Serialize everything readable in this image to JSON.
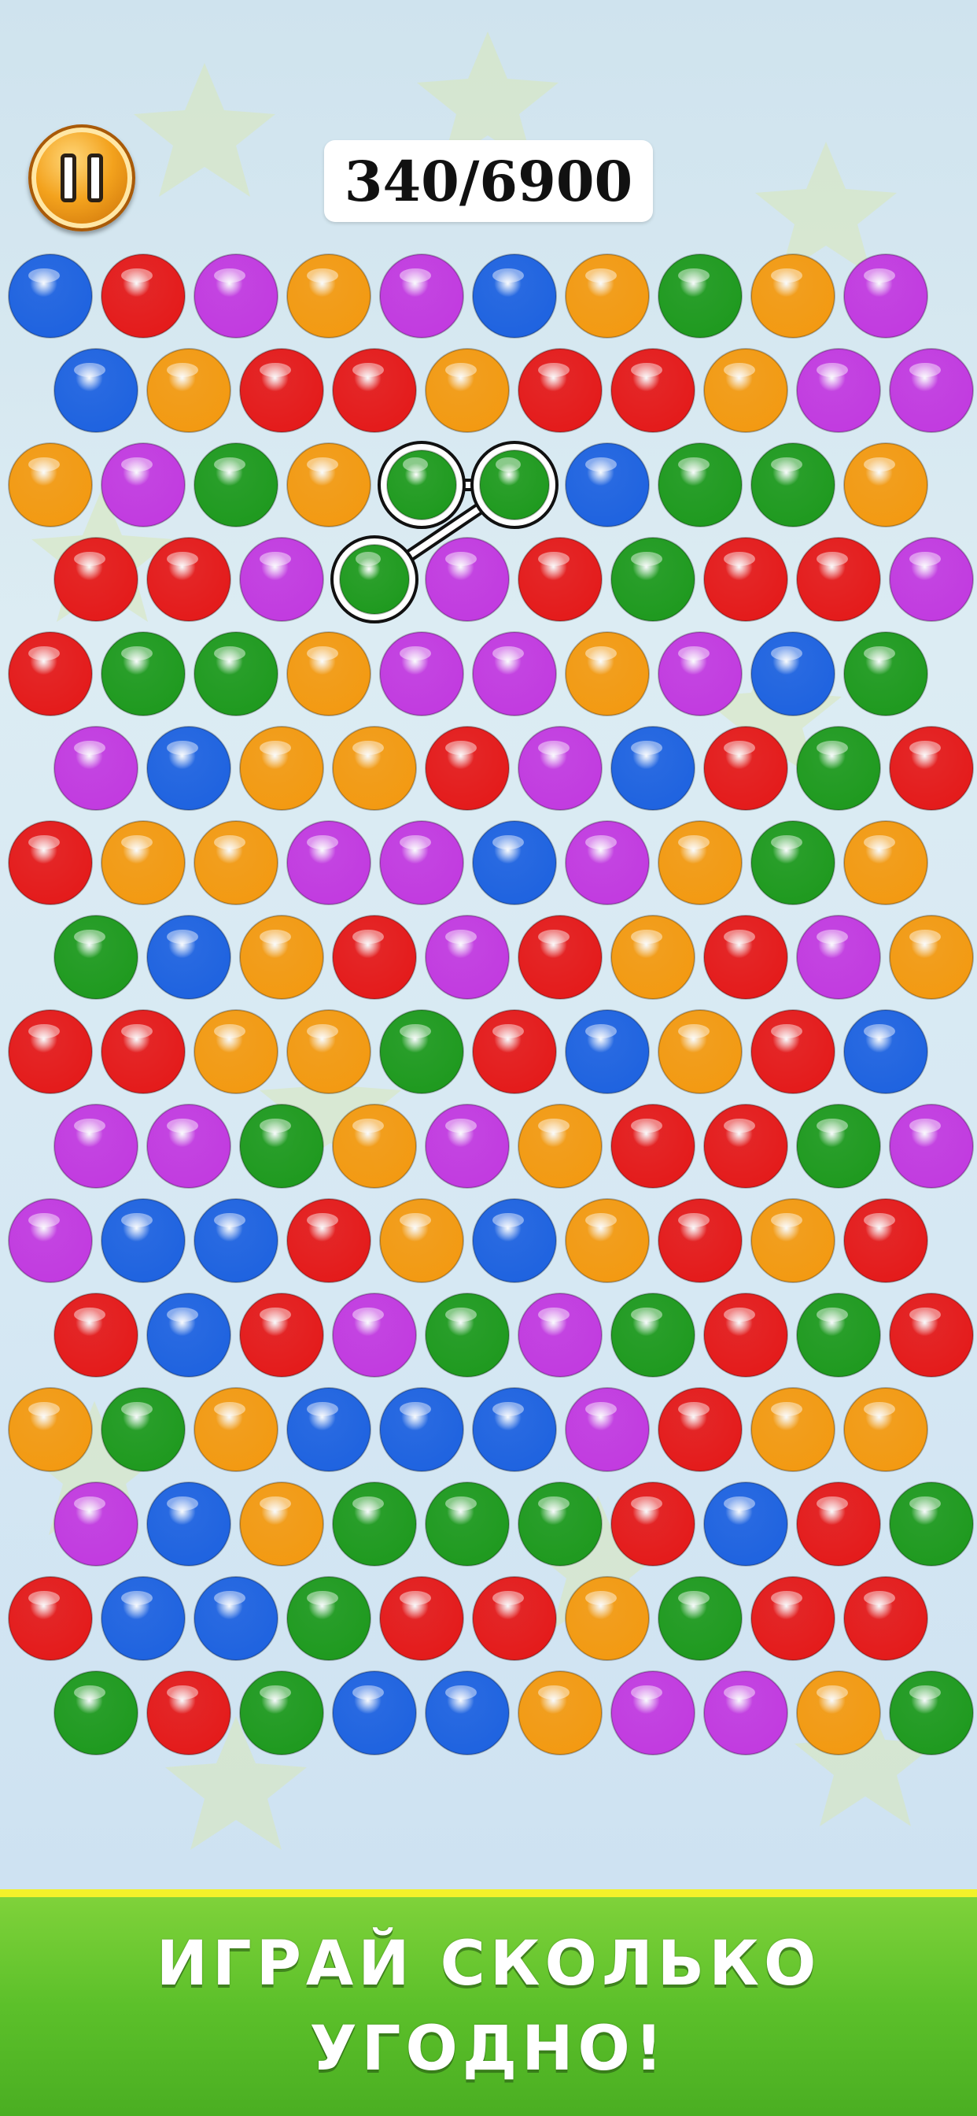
{
  "hud": {
    "score_text": "340/6900",
    "pause_icon": "pause-icon"
  },
  "board": {
    "rows": [
      [
        "blue",
        "red",
        "purple",
        "orange",
        "purple",
        "blue",
        "orange",
        "green",
        "orange",
        "purple"
      ],
      [
        "blue",
        "orange",
        "red",
        "red",
        "orange",
        "red",
        "red",
        "orange",
        "purple",
        "purple"
      ],
      [
        "orange",
        "purple",
        "green",
        "orange",
        "green",
        "green",
        "blue",
        "green",
        "green",
        "orange"
      ],
      [
        "red",
        "red",
        "purple",
        "green",
        "purple",
        "red",
        "green",
        "red",
        "red",
        "purple"
      ],
      [
        "red",
        "green",
        "green",
        "orange",
        "purple",
        "purple",
        "orange",
        "purple",
        "blue",
        "green"
      ],
      [
        "purple",
        "blue",
        "orange",
        "orange",
        "red",
        "purple",
        "blue",
        "red",
        "green",
        "red"
      ],
      [
        "red",
        "orange",
        "orange",
        "purple",
        "purple",
        "blue",
        "purple",
        "orange",
        "green",
        "orange"
      ],
      [
        "green",
        "blue",
        "orange",
        "red",
        "purple",
        "red",
        "orange",
        "red",
        "purple",
        "orange"
      ],
      [
        "red",
        "red",
        "orange",
        "orange",
        "green",
        "red",
        "blue",
        "orange",
        "red",
        "blue"
      ],
      [
        "purple",
        "purple",
        "green",
        "orange",
        "purple",
        "orange",
        "red",
        "red",
        "green",
        "purple"
      ],
      [
        "purple",
        "blue",
        "blue",
        "red",
        "orange",
        "blue",
        "orange",
        "red",
        "orange",
        "red"
      ],
      [
        "red",
        "blue",
        "red",
        "purple",
        "green",
        "purple",
        "green",
        "red",
        "green",
        "red"
      ],
      [
        "orange",
        "green",
        "orange",
        "blue",
        "blue",
        "blue",
        "purple",
        "red",
        "orange",
        "orange"
      ],
      [
        "purple",
        "blue",
        "orange",
        "green",
        "green",
        "green",
        "red",
        "blue",
        "red",
        "green"
      ],
      [
        "red",
        "blue",
        "blue",
        "green",
        "red",
        "red",
        "orange",
        "green",
        "red",
        "red"
      ],
      [
        "green",
        "red",
        "green",
        "blue",
        "blue",
        "orange",
        "purple",
        "purple",
        "orange",
        "green"
      ]
    ],
    "selected_chain": [
      [
        2,
        4
      ],
      [
        2,
        5
      ],
      [
        3,
        3
      ]
    ]
  },
  "colors": {
    "blue": "#1f63e0",
    "red": "#e41b1b",
    "purple": "#c23be0",
    "orange": "#f39a12",
    "green": "#1f9a1f",
    "selection_outline": "#111111",
    "banner_green": "#5cc02a",
    "banner_border": "#f3f12a"
  },
  "banner": {
    "line1": "ИГРАЙ СКОЛЬКО",
    "line2": "УГОДНО!"
  }
}
